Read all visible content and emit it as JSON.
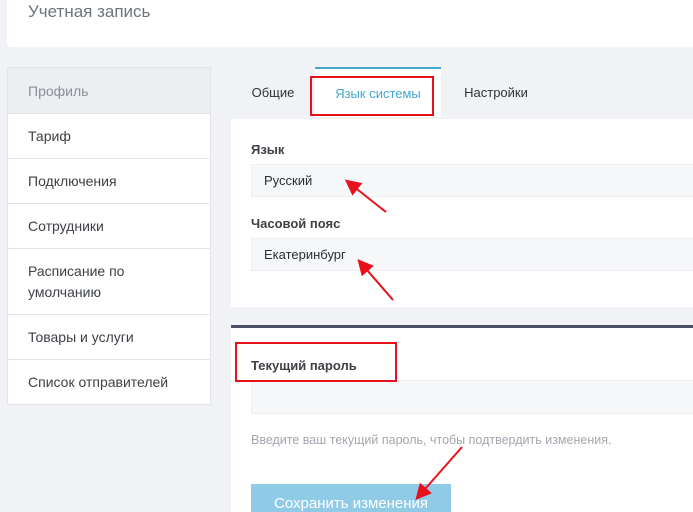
{
  "header": {
    "title": "Учетная запись"
  },
  "sidebar": {
    "items": [
      {
        "label": "Профиль"
      },
      {
        "label": "Тариф"
      },
      {
        "label": "Подключения"
      },
      {
        "label": "Сотрудники"
      },
      {
        "label": "Расписание по умолчанию"
      },
      {
        "label": "Товары и услуги"
      },
      {
        "label": "Список отправителей"
      }
    ]
  },
  "tabs": [
    {
      "label": "Общие"
    },
    {
      "label": "Язык системы"
    },
    {
      "label": "Настройки"
    }
  ],
  "language_card": {
    "language_label": "Язык",
    "language_value": "Русский",
    "timezone_label": "Часовой пояс",
    "timezone_value": "Екатеринбург"
  },
  "password_card": {
    "label": "Текущий пароль",
    "value": "",
    "hint": "Введите ваш текущий пароль, чтобы подтвердить изменения.",
    "save_label": "Сохранить изменения"
  },
  "colors": {
    "accent": "#45a6cf",
    "annotation": "#e8111b",
    "button": "#8fcbe6"
  }
}
